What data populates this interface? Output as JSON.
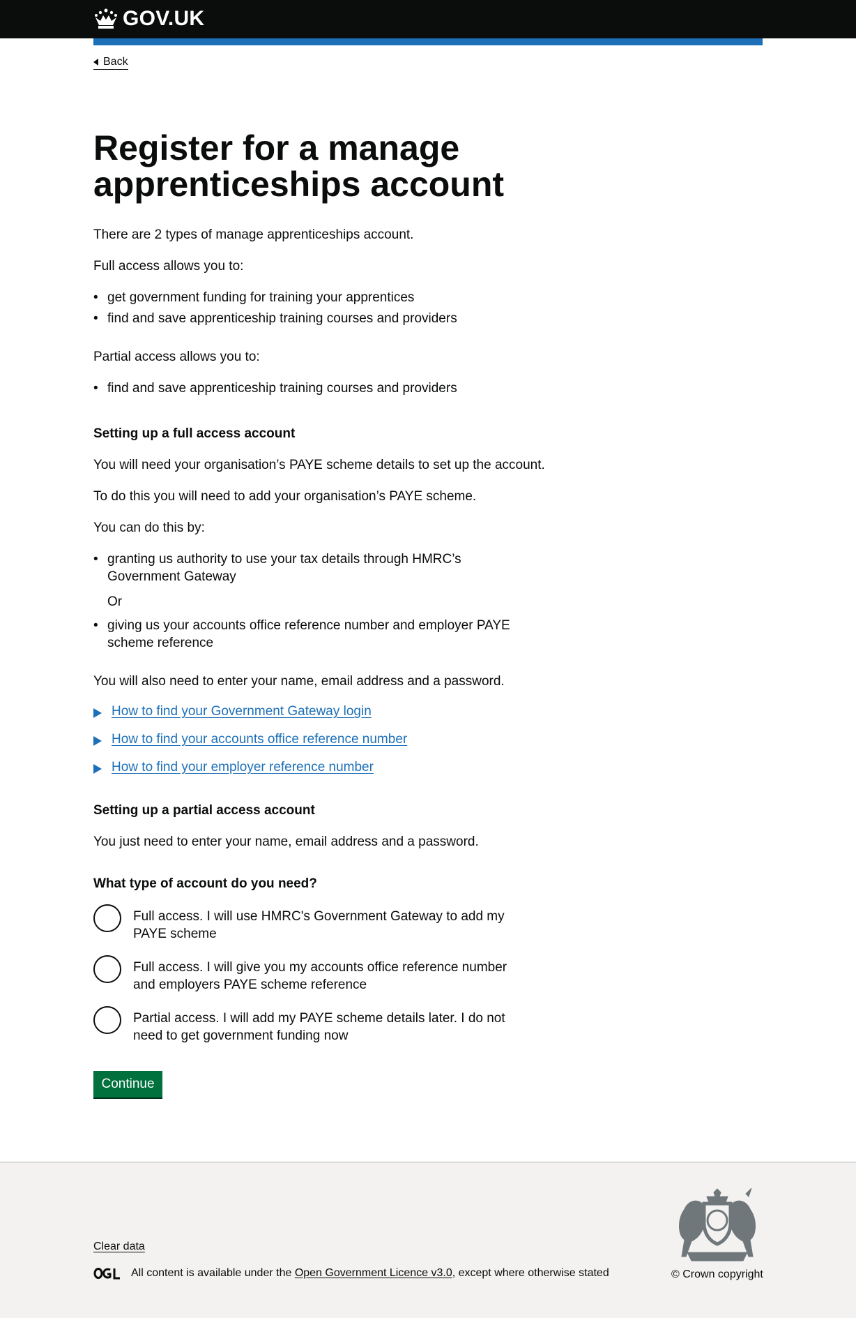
{
  "header": {
    "logo_text": "GOV.UK",
    "brand_color": "#1d70b8"
  },
  "nav": {
    "back_label": "Back"
  },
  "main": {
    "title": "Register for a manage apprenticeships account",
    "intro": "There are 2 types of manage apprenticeships account.",
    "full_access_intro": "Full access allows you to:",
    "full_access_items": [
      "get government funding for training your apprentices",
      "find and save apprenticeship training courses and providers"
    ],
    "partial_access_intro": "Partial access allows you to:",
    "partial_access_items": [
      "find and save apprenticeship training courses and providers"
    ],
    "full_heading": "Setting up a full access account",
    "full_p1": "You will need your organisation’s PAYE scheme details to set up the account.",
    "full_p2": "To do this you will need to add your organisation’s PAYE scheme.",
    "full_p3": "You can do this by:",
    "full_option_1": "granting us authority to use your tax details through HMRC’s Government Gateway",
    "full_or": "Or",
    "full_option_2": "giving us your accounts office reference number and employer PAYE scheme reference",
    "full_p4": "You will also need to enter your name, email address and a password.",
    "details": [
      "How to find your Government Gateway login",
      "How to find your accounts office reference number",
      "How to find your employer reference number"
    ],
    "partial_heading": "Setting up a partial access account",
    "partial_p1": "You just need to enter your name, email address and a password.",
    "question": "What type of account do you need?",
    "radios": [
      "Full access. I will use HMRC's Government Gateway to add my PAYE scheme",
      "Full access. I will give you my accounts office reference number and employers PAYE scheme reference",
      "Partial access. I will add my PAYE scheme details later. I do not need to get government funding now"
    ],
    "continue_label": "Continue",
    "button_color": "#00703c"
  },
  "footer": {
    "clear_data_label": "Clear data",
    "licence_prefix": "All content is available under the ",
    "licence_link": "Open Government Licence v3.0",
    "licence_suffix": ", except where otherwise stated",
    "copyright": "© Crown copyright"
  }
}
